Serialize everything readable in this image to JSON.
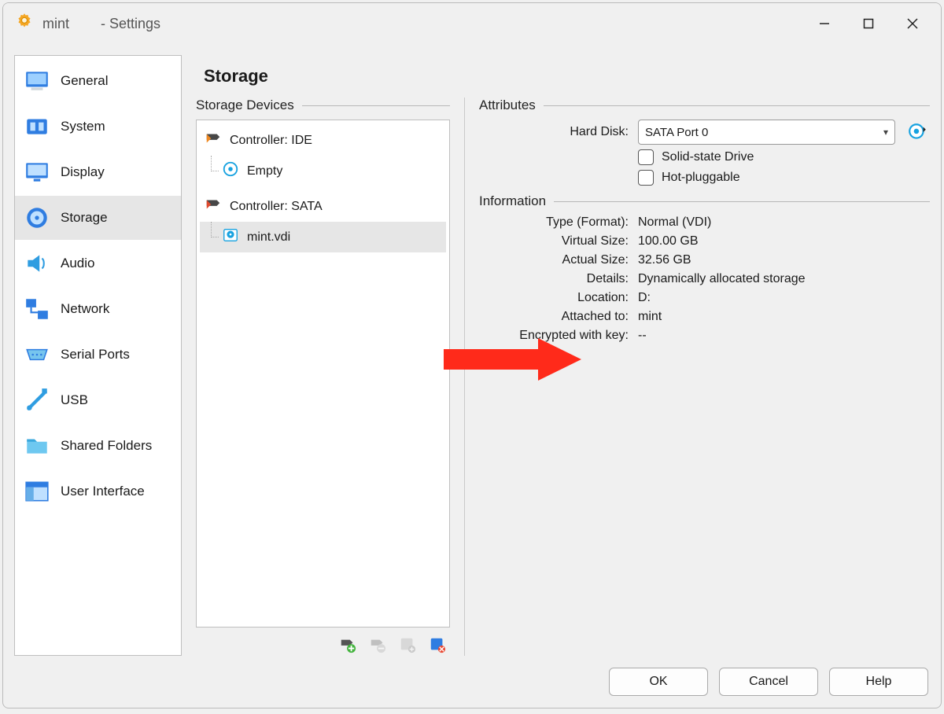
{
  "window": {
    "title_left": "mint",
    "title_right": "- Settings"
  },
  "sidebar": {
    "items": [
      {
        "key": "general",
        "label": "General"
      },
      {
        "key": "system",
        "label": "System"
      },
      {
        "key": "display",
        "label": "Display"
      },
      {
        "key": "storage",
        "label": "Storage",
        "selected": true
      },
      {
        "key": "audio",
        "label": "Audio"
      },
      {
        "key": "network",
        "label": "Network"
      },
      {
        "key": "serial-ports",
        "label": "Serial Ports"
      },
      {
        "key": "usb",
        "label": "USB"
      },
      {
        "key": "shared-folders",
        "label": "Shared Folders"
      },
      {
        "key": "user-interface",
        "label": "User Interface"
      }
    ]
  },
  "page": {
    "title": "Storage"
  },
  "storage_devices": {
    "header": "Storage Devices",
    "controllers": [
      {
        "label": "Controller: IDE",
        "children": [
          {
            "label": "Empty"
          }
        ]
      },
      {
        "label": "Controller: SATA",
        "children": [
          {
            "label": "mint.vdi",
            "selected": true
          }
        ]
      }
    ]
  },
  "attributes": {
    "header": "Attributes",
    "hard_disk_label": "Hard Disk:",
    "hard_disk_value": "SATA Port 0",
    "ssd_label": "Solid-state Drive",
    "hotplug_label": "Hot-pluggable"
  },
  "information": {
    "header": "Information",
    "rows": {
      "type_label": "Type (Format):",
      "type_value": "Normal (VDI)",
      "vsize_label": "Virtual Size:",
      "vsize_value": "100.00 GB",
      "asize_label": "Actual Size:",
      "asize_value": "32.56 GB",
      "details_label": "Details:",
      "details_value": "Dynamically allocated storage",
      "location_label": "Location:",
      "location_value": "D:",
      "attached_label": "Attached to:",
      "attached_value": "mint",
      "encrypted_label": "Encrypted with key:",
      "encrypted_value": "--"
    }
  },
  "footer": {
    "ok": "OK",
    "cancel": "Cancel",
    "help": "Help"
  }
}
